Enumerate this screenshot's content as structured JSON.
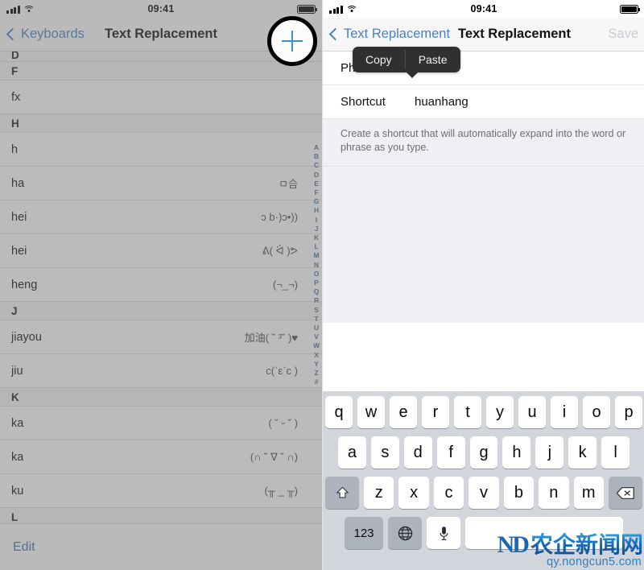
{
  "left": {
    "status": {
      "time": "09:41",
      "signal_icon": "signal-bars-icon",
      "wifi_icon": "wifi-icon",
      "battery_icon": "battery-icon"
    },
    "nav": {
      "back_label": "Keyboards",
      "title": "Text Replacement",
      "add_button_icon": "plus-icon"
    },
    "list": [
      {
        "type": "header",
        "label": "D",
        "clipped": true
      },
      {
        "type": "header",
        "label": "F"
      },
      {
        "type": "entry",
        "shortcut": "fx",
        "phrase": ""
      },
      {
        "type": "header",
        "label": "H"
      },
      {
        "type": "entry",
        "shortcut": "h",
        "phrase": ""
      },
      {
        "type": "entry",
        "shortcut": "ha",
        "phrase": "ㅁ슴"
      },
      {
        "type": "entry",
        "shortcut": "hei",
        "phrase": "ɔ b·)ɔ•))"
      },
      {
        "type": "entry",
        "shortcut": "hei",
        "phrase": "ᕕ( ᐛ )ᕗ"
      },
      {
        "type": "entry",
        "shortcut": "heng",
        "phrase": "(¬_¬)"
      },
      {
        "type": "header",
        "label": "J"
      },
      {
        "type": "entry",
        "shortcut": "jiayou",
        "phrase": "加油( ˘ ³˘ )♥"
      },
      {
        "type": "entry",
        "shortcut": "jiu",
        "phrase": "c(ˊεˋc )"
      },
      {
        "type": "header",
        "label": "K"
      },
      {
        "type": "entry",
        "shortcut": "ka",
        "phrase": "( ˘ ᵕ ˘ )"
      },
      {
        "type": "entry",
        "shortcut": "ka",
        "phrase": "(∩ ˘ ∇ ˘ ∩)"
      },
      {
        "type": "entry",
        "shortcut": "ku",
        "phrase": "(╥ _ ╥)"
      },
      {
        "type": "header",
        "label": "L"
      }
    ],
    "index": [
      "A",
      "B",
      "C",
      "D",
      "E",
      "F",
      "G",
      "H",
      "I",
      "J",
      "K",
      "L",
      "M",
      "N",
      "O",
      "P",
      "Q",
      "R",
      "S",
      "T",
      "U",
      "V",
      "W",
      "X",
      "Y",
      "Z",
      "#"
    ],
    "edit_label": "Edit"
  },
  "right": {
    "status": {
      "time": "09:41",
      "signal_icon": "signal-bars-icon",
      "wifi_icon": "wifi-icon",
      "battery_icon": "battery-icon"
    },
    "nav": {
      "back_label": "Text Replacement",
      "title": "Text Replacement",
      "save_label": "Save"
    },
    "context_menu": {
      "copy_label": "Copy",
      "paste_label": "Paste"
    },
    "form": {
      "phrase_label": "Phrase",
      "phrase_value": "",
      "shortcut_label": "Shortcut",
      "shortcut_value": "huanhang",
      "footer_text": "Create a shortcut that will automatically expand into the word or phrase as you type."
    },
    "keyboard": {
      "row1": [
        "q",
        "w",
        "e",
        "r",
        "t",
        "y",
        "u",
        "i",
        "o",
        "p"
      ],
      "row2": [
        "a",
        "s",
        "d",
        "f",
        "g",
        "h",
        "j",
        "k",
        "l"
      ],
      "row3": [
        "z",
        "x",
        "c",
        "v",
        "b",
        "n",
        "m"
      ],
      "shift_icon": "shift-arrow-icon",
      "delete_icon": "backspace-icon",
      "numbers_label": "123",
      "globe_icon": "globe-icon",
      "mic_icon": "microphone-icon",
      "space_label": ""
    }
  },
  "watermark": {
    "logo_text": "ND",
    "site_name": "农企新闻网",
    "url": "qy.nongcun5.com"
  },
  "colors": {
    "accent_blue": "#4a7fc1",
    "plus_blue": "#3e8ed0",
    "index_blue": "#4a6fa5",
    "menu_dark": "#303033",
    "keyboard_bg": "#d2d5db"
  }
}
